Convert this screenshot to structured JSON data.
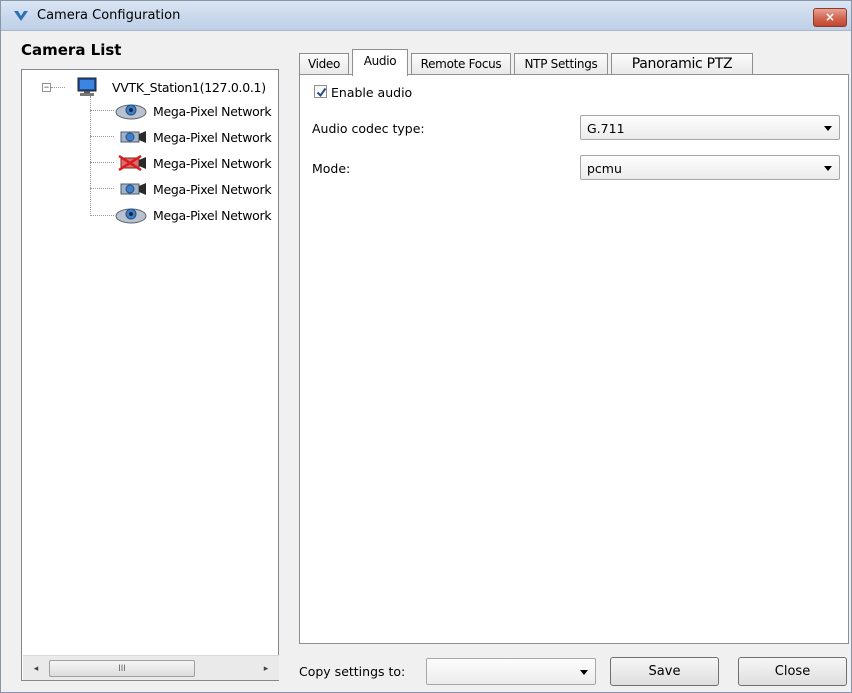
{
  "window": {
    "title": "Camera Configuration",
    "close_glyph": "×",
    "app_icon": "app-logo-icon"
  },
  "camera_list": {
    "header": "Camera List",
    "station": {
      "label": "VVTK_Station1(127.0.0.1)",
      "expander": "−",
      "icon": "computer-icon"
    },
    "cameras": [
      {
        "label": "Mega-Pixel Network",
        "icon": "dome-camera-icon",
        "status": "online"
      },
      {
        "label": "Mega-Pixel Network",
        "icon": "box-camera-icon",
        "status": "online"
      },
      {
        "label": "Mega-Pixel Network",
        "icon": "box-camera-disconnected-icon",
        "status": "disconnected"
      },
      {
        "label": "Mega-Pixel Network",
        "icon": "box-camera-icon",
        "status": "online"
      },
      {
        "label": "Mega-Pixel Network",
        "icon": "dome-camera-icon",
        "status": "online"
      }
    ],
    "scroll": {
      "left": "◂",
      "right": "▸",
      "grip": "III"
    }
  },
  "tabs": [
    {
      "label": "Video",
      "active": false
    },
    {
      "label": "Audio",
      "active": true
    },
    {
      "label": "Remote Focus",
      "active": false
    },
    {
      "label": "NTP Settings",
      "active": false
    },
    {
      "label": "Panoramic PTZ",
      "active": false
    }
  ],
  "audio": {
    "enable_audio_label": "Enable audio",
    "enable_audio_checked": true,
    "codec_label": "Audio codec type:",
    "codec_value": "G.711",
    "mode_label": "Mode:",
    "mode_value": "pcmu"
  },
  "footer": {
    "copy_label": "Copy settings to:",
    "copy_value": "",
    "save_label": "Save",
    "close_label": "Close"
  },
  "colors": {
    "titlebar": "#c9d8ec",
    "close_button": "#d26a55",
    "camera_blue": "#3f7fc8",
    "disconnected_red": "#d42020"
  }
}
